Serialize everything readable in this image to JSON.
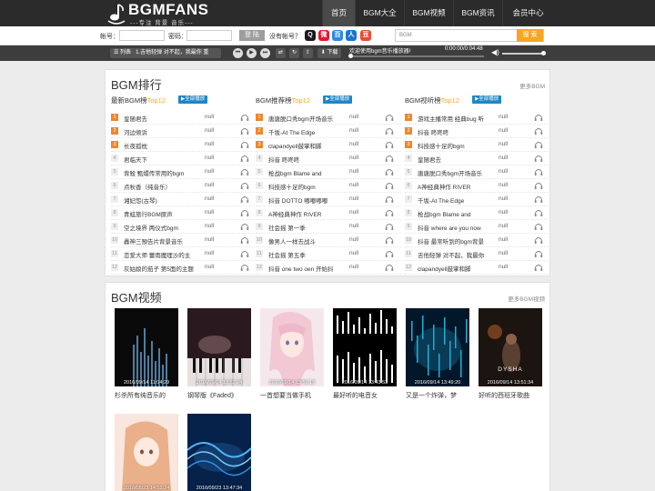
{
  "site": {
    "logo_text": "BGMFANS",
    "logo_sub": "---专注 背景 音乐---"
  },
  "nav": [
    {
      "label": "首页",
      "active": true
    },
    {
      "label": "BGM大全",
      "active": false
    },
    {
      "label": "BGM视频",
      "active": false
    },
    {
      "label": "BGM资讯",
      "active": false
    },
    {
      "label": "会员中心",
      "active": false
    }
  ],
  "login": {
    "account_label": "帐号：",
    "password_label": "密码：",
    "login_button": "登 陆",
    "no_account_text": "没有帐号？",
    "search_placeholder": "BGM",
    "search_button": "搜 索"
  },
  "player": {
    "list_label": "列表",
    "current_track": "1.吉他轻弹 对不起，我最你 重",
    "download_label": "下载",
    "now_playing": "欢迎使用bgm音乐播放器!",
    "time": "0:00:00/0:04:48",
    "progress": 0,
    "volume": 1
  },
  "ranking": {
    "title": "BGM排行",
    "more": "更多BGM",
    "play_all": "全部播放",
    "columns": [
      {
        "head": "最新BGM榜",
        "top": "Top12",
        "items": [
          {
            "name": "皇随君去",
            "value": "null"
          },
          {
            "name": "河边倾诉",
            "value": "null"
          },
          {
            "name": "长夜孤枕",
            "value": "null"
          },
          {
            "name": "君临天下",
            "value": "null"
          },
          {
            "name": "背殺 甄嬛传常用的bgm",
            "value": "null"
          },
          {
            "name": "点秋香（纯音乐）",
            "value": "null"
          },
          {
            "name": "湘妃怨(古琴)",
            "value": "null"
          },
          {
            "name": "青蛙旅行BGM原声",
            "value": "null"
          },
          {
            "name": "空之境界 两仪式bgm",
            "value": "null"
          },
          {
            "name": "轟神三預告片背景音乐",
            "value": "null"
          },
          {
            "name": "恋爱大师 蕾雨魔理沙的主",
            "value": "null"
          },
          {
            "name": "灰姑娘的茄子 第5面的主题",
            "value": "null"
          }
        ]
      },
      {
        "head": "BGM推荐榜",
        "top": "Top12",
        "items": [
          {
            "name": "唐唐脱口秀bgm开场音乐",
            "value": "null"
          },
          {
            "name": "千坂-At The Edge",
            "value": "null"
          },
          {
            "name": "clapandyell鼓掌和脚",
            "value": "null"
          },
          {
            "name": "抖音 咚咚咚",
            "value": "null"
          },
          {
            "name": "枪战bgm Blame and",
            "value": "null"
          },
          {
            "name": "科技感十足的bgm",
            "value": "null"
          },
          {
            "name": "抖音 DOTTO 嘟嘟嘟嘟",
            "value": "null"
          },
          {
            "name": "A神经典神作 RIVER",
            "value": "null"
          },
          {
            "name": "社会摇 第一季",
            "value": "null"
          },
          {
            "name": "像男人一样去战斗",
            "value": "null"
          },
          {
            "name": "社会摇 第五季",
            "value": "null"
          },
          {
            "name": "抖音 one two oen 开始抖",
            "value": "null"
          }
        ]
      },
      {
        "head": "BGM视听榜",
        "top": "Top12",
        "items": [
          {
            "name": "游戏主播常用 经典bug 听",
            "value": "null"
          },
          {
            "name": "抖音 咚咚咚",
            "value": "null"
          },
          {
            "name": "科技感十足的bgm",
            "value": "null"
          },
          {
            "name": "皇随君去",
            "value": "null"
          },
          {
            "name": "唐唐脱口秀bgm开场音乐",
            "value": "null"
          },
          {
            "name": "A神经典神作 RIVER",
            "value": "null"
          },
          {
            "name": "千坂-At The Edge",
            "value": "null"
          },
          {
            "name": "枪战bgm Blame and",
            "value": "null"
          },
          {
            "name": "抖音 where are you now",
            "value": "null"
          },
          {
            "name": "抖音 最常听到的bgm背景",
            "value": "null"
          },
          {
            "name": "吉他轻弹 对不起，我最你",
            "value": "null"
          },
          {
            "name": "clapandyell鼓掌和脚",
            "value": "null"
          }
        ]
      }
    ]
  },
  "videos": {
    "title": "BGM视频",
    "more": "更多BGM视频",
    "items": [
      {
        "date": "2016/09/14 11:04:29",
        "title": "杉杀所有纯音乐的"
      },
      {
        "date": "2016/09/14 13:52:24",
        "title": "钢琴版《Faded》"
      },
      {
        "date": "2016/09/14 13:50:19",
        "title": "一首想要当做手机"
      },
      {
        "date": "2016/09/14 13:43:53",
        "title": "最好听的电音女"
      },
      {
        "date": "2016/09/14 13:49:20",
        "title": "又是一个炸弹，梦"
      },
      {
        "date": "2016/09/14 13:51:34",
        "title": "好听的西班牙歌曲",
        "overlay": "DYSHA"
      },
      {
        "date": "2016/08/23 14:51:24",
        "title": ""
      },
      {
        "date": "2016/09/23 13:47:34",
        "title": ""
      }
    ]
  }
}
